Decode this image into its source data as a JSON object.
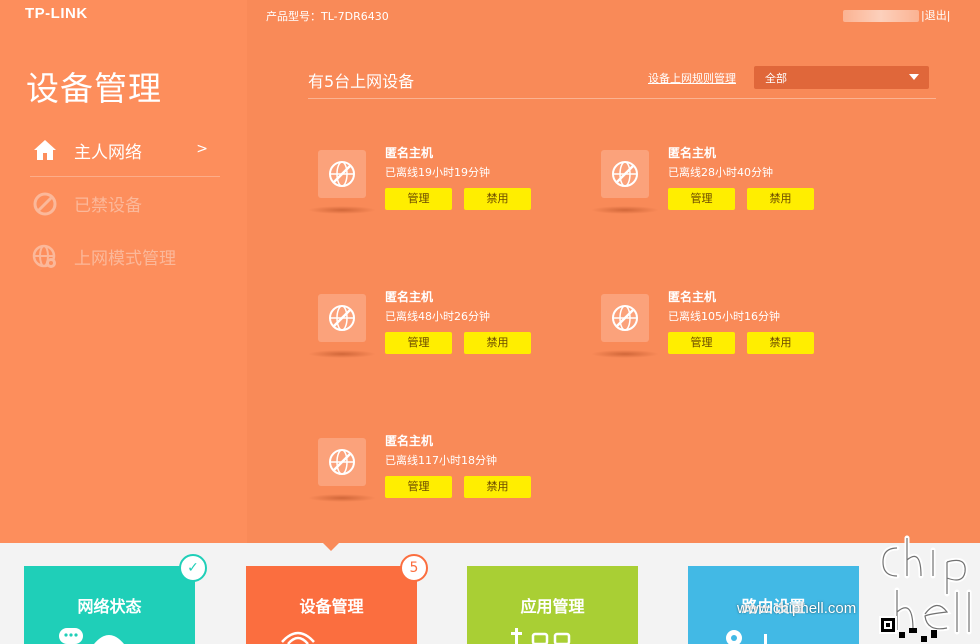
{
  "header": {
    "brand": "TP-LINK",
    "model_label": "产品型号：TL-7DR6430",
    "logout": "|退出|"
  },
  "sidebar": {
    "title": "设备管理",
    "items": [
      {
        "label": "主人网络",
        "icon": "home-icon",
        "arrow": ">"
      },
      {
        "label": "已禁设备",
        "icon": "ban-icon"
      },
      {
        "label": "上网模式管理",
        "icon": "globe-gear-icon"
      }
    ]
  },
  "main": {
    "title": "有5台上网设备",
    "rules_link": "设备上网规则管理",
    "filter": {
      "selected": "全部"
    },
    "devices": [
      {
        "name": "匿名主机",
        "status": "已离线19小时19分钟",
        "manage": "管理",
        "ban": "禁用"
      },
      {
        "name": "匿名主机",
        "status": "已离线28小时40分钟",
        "manage": "管理",
        "ban": "禁用"
      },
      {
        "name": "匿名主机",
        "status": "已离线48小时26分钟",
        "manage": "管理",
        "ban": "禁用"
      },
      {
        "name": "匿名主机",
        "status": "已离线105小时16分钟",
        "manage": "管理",
        "ban": "禁用"
      },
      {
        "name": "匿名主机",
        "status": "已离线117小时18分钟",
        "manage": "管理",
        "ban": "禁用"
      }
    ]
  },
  "bottom": {
    "tiles": [
      {
        "label": "网络状态",
        "color": "#1fcfb8",
        "badge": "✓"
      },
      {
        "label": "设备管理",
        "color": "#fb6e3f",
        "badge": "5"
      },
      {
        "label": "应用管理",
        "color": "#a9cf34"
      },
      {
        "label": "路由设置",
        "color": "#42b9e5"
      }
    ],
    "watermark": "www.chiphell.com"
  },
  "colors": {
    "accent_orange": "#f98a58",
    "button_yellow": "#ffee00"
  }
}
